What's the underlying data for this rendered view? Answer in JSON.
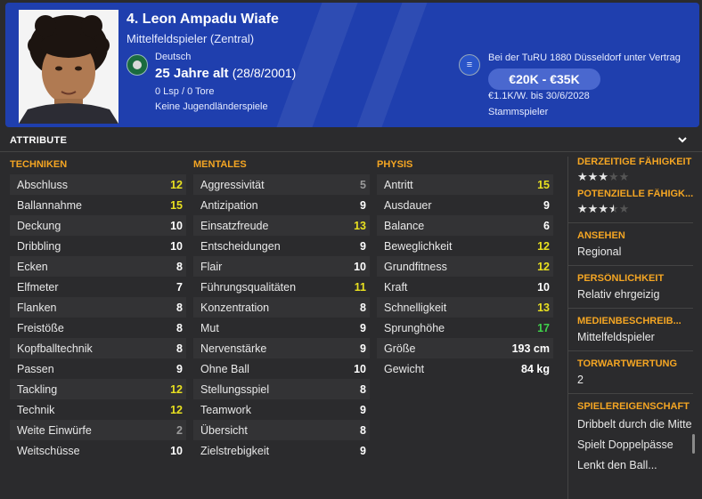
{
  "header": {
    "name": "4. Leon Ampadu Wiafe",
    "position": "Mittelfeldspieler (Zentral)",
    "nationality": "Deutsch",
    "age": "25 Jahre alt",
    "dob": "(28/8/2001)",
    "caps": "0 Lsp / 0 Tore",
    "youth": "Keine Jugendländerspiele",
    "contract": "Bei der TuRU 1880 Düsseldorf unter Vertrag",
    "value": "€20K - €35K",
    "wage": "€1.1K/W. bis 30/6/2028",
    "role": "Stammspieler",
    "color": "#1f3fae"
  },
  "section": {
    "title": "ATTRIBUTE",
    "collapse_icon": "chevron-down-icon"
  },
  "colors": {
    "orange": "#f5a623",
    "white": "#e8e8e8",
    "yellow": "#e8e020",
    "green": "#3fd24a",
    "grey": "#9a9a9a"
  },
  "technical": {
    "heading": "TECHNIKEN",
    "rows": [
      {
        "label": "Abschluss",
        "value": "12"
      },
      {
        "label": "Ballannahme",
        "value": "15"
      },
      {
        "label": "Deckung",
        "value": "10"
      },
      {
        "label": "Dribbling",
        "value": "10"
      },
      {
        "label": "Ecken",
        "value": "8"
      },
      {
        "label": "Elfmeter",
        "value": "7"
      },
      {
        "label": "Flanken",
        "value": "8"
      },
      {
        "label": "Freistöße",
        "value": "8"
      },
      {
        "label": "Kopfballtechnik",
        "value": "8"
      },
      {
        "label": "Passen",
        "value": "9"
      },
      {
        "label": "Tackling",
        "value": "12"
      },
      {
        "label": "Technik",
        "value": "12"
      },
      {
        "label": "Weite Einwürfe",
        "value": "2"
      },
      {
        "label": "Weitschüsse",
        "value": "10"
      }
    ]
  },
  "mental": {
    "heading": "MENTALES",
    "rows": [
      {
        "label": "Aggressivität",
        "value": "5"
      },
      {
        "label": "Antizipation",
        "value": "9"
      },
      {
        "label": "Einsatzfreude",
        "value": "13"
      },
      {
        "label": "Entscheidungen",
        "value": "9"
      },
      {
        "label": "Flair",
        "value": "10"
      },
      {
        "label": "Führungsqualitäten",
        "value": "11"
      },
      {
        "label": "Konzentration",
        "value": "8"
      },
      {
        "label": "Mut",
        "value": "9"
      },
      {
        "label": "Nervenstärke",
        "value": "9"
      },
      {
        "label": "Ohne Ball",
        "value": "10"
      },
      {
        "label": "Stellungsspiel",
        "value": "8"
      },
      {
        "label": "Teamwork",
        "value": "9"
      },
      {
        "label": "Übersicht",
        "value": "8"
      },
      {
        "label": "Zielstrebigkeit",
        "value": "9"
      }
    ]
  },
  "physical": {
    "heading": "PHYSIS",
    "rows": [
      {
        "label": "Antritt",
        "value": "15"
      },
      {
        "label": "Ausdauer",
        "value": "9"
      },
      {
        "label": "Balance",
        "value": "6"
      },
      {
        "label": "Beweglichkeit",
        "value": "12"
      },
      {
        "label": "Grundfitness",
        "value": "12"
      },
      {
        "label": "Kraft",
        "value": "10"
      },
      {
        "label": "Schnelligkeit",
        "value": "13"
      },
      {
        "label": "Sprunghöhe",
        "value": "17"
      },
      {
        "label": "Größe",
        "value": "193 cm"
      },
      {
        "label": "Gewicht",
        "value": "84 kg"
      }
    ]
  },
  "side": {
    "current_ability_label": "DERZEITIGE FÄHIGKEIT",
    "current_ability_stars": 3,
    "potential_ability_label": "POTENZIELLE FÄHIGK...",
    "potential_ability_stars": 3.5,
    "star_max": 5,
    "reputation_label": "ANSEHEN",
    "reputation": "Regional",
    "personality_label": "PERSÖNLICHKEIT",
    "personality": "Relativ ehrgeizig",
    "media_label": "MEDIENBESCHREIB...",
    "media": "Mittelfeldspieler",
    "gk_label": "TORWARTWERTUNG",
    "gk": "2",
    "traits_label": "SPIELEREIGENSCHAFT",
    "traits": [
      "Dribbelt durch die Mitte",
      "Spielt Doppelpässe",
      "Lenkt den Ball..."
    ]
  }
}
